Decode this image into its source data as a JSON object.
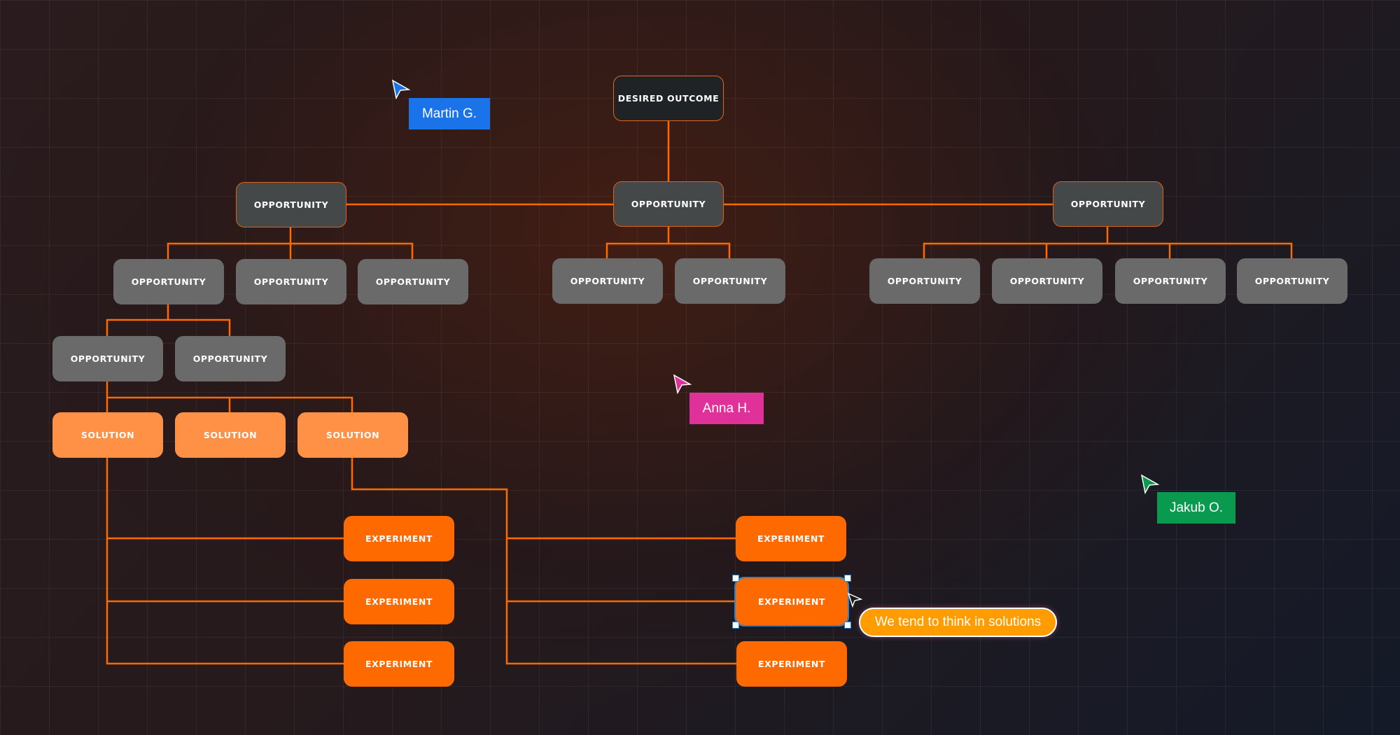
{
  "diagram": {
    "outcome": "DESIRED OUTCOME",
    "level1": [
      "OPPORTUNITY",
      "OPPORTUNITY",
      "OPPORTUNITY"
    ],
    "level2": [
      "OPPORTUNITY",
      "OPPORTUNITY",
      "OPPORTUNITY",
      "OPPORTUNITY",
      "OPPORTUNITY",
      "OPPORTUNITY",
      "OPPORTUNITY",
      "OPPORTUNITY",
      "OPPORTUNITY"
    ],
    "level3": [
      "OPPORTUNITY",
      "OPPORTUNITY"
    ],
    "solutions": [
      "SOLUTION",
      "SOLUTION",
      "SOLUTION"
    ],
    "experiments": [
      "EXPERIMENT",
      "EXPERIMENT",
      "EXPERIMENT",
      "EXPERIMENT",
      "EXPERIMENT",
      "EXPERIMENT"
    ]
  },
  "collaborators": [
    {
      "name": "Martin G.",
      "color": "#1a73e8"
    },
    {
      "name": "Anna H.",
      "color": "#e0309a"
    },
    {
      "name": "Jakub O.",
      "color": "#0a9a4f"
    }
  ],
  "tooltip": "We tend to think in solutions",
  "colors": {
    "connector": "#ff6a00",
    "solution": "#ff9147",
    "experiment": "#ff6a00"
  }
}
